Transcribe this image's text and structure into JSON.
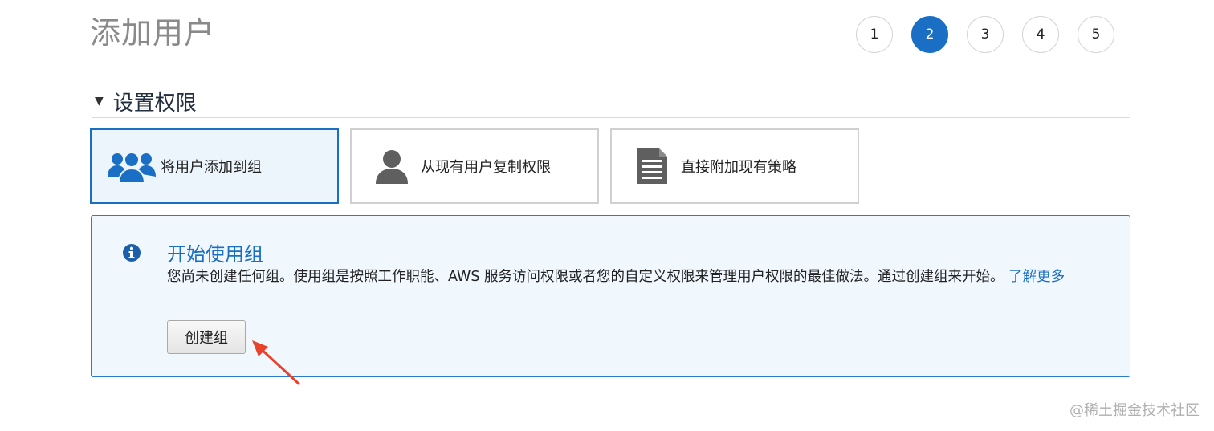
{
  "page": {
    "title": "添加用户"
  },
  "steps": [
    {
      "label": "1",
      "active": false
    },
    {
      "label": "2",
      "active": true
    },
    {
      "label": "3",
      "active": false
    },
    {
      "label": "4",
      "active": false
    },
    {
      "label": "5",
      "active": false
    }
  ],
  "section": {
    "title": "设置权限",
    "caret_icon": "caret-down-icon"
  },
  "options": [
    {
      "label": "将用户添加到组",
      "icon": "users-group-icon",
      "selected": true
    },
    {
      "label": "从现有用户复制权限",
      "icon": "user-icon",
      "selected": false
    },
    {
      "label": "直接附加现有策略",
      "icon": "document-icon",
      "selected": false
    }
  ],
  "info_panel": {
    "icon": "info-icon",
    "title": "开始使用组",
    "body": "您尚未创建任何组。使用组是按照工作职能、AWS 服务访问权限或者您的自定义权限来管理用户权限的最佳做法。通过创建组来开始。",
    "learn_more": "了解更多",
    "create_button": "创建组"
  },
  "annotation": {
    "icon": "red-arrow-icon"
  },
  "watermark": "@稀土掘金技术社区",
  "colors": {
    "accent": "#1a6fc4",
    "selected_bg": "#ecf4fc",
    "info_bg": "#f0f7fd",
    "arrow": "#e8412c"
  }
}
